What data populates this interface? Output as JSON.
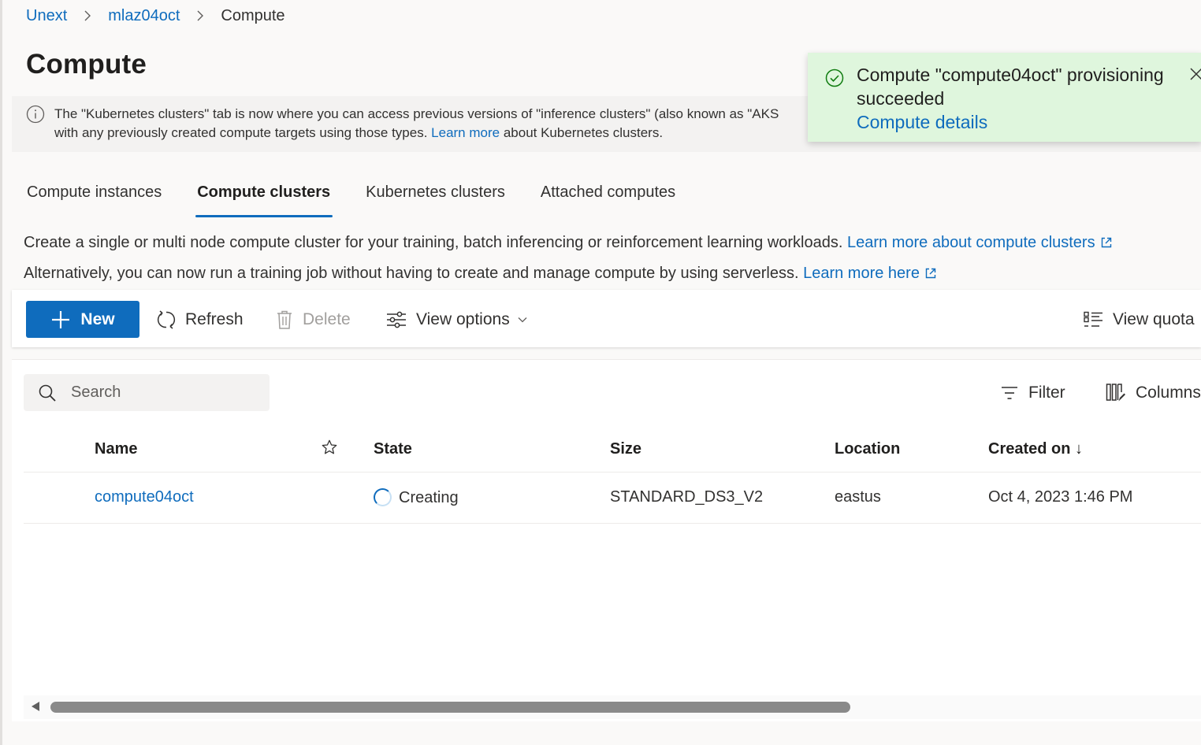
{
  "breadcrumb": [
    "Unext",
    "mlaz04oct",
    "Compute"
  ],
  "page_title": "Compute",
  "banner": {
    "line1": "The \"Kubernetes clusters\" tab is now where you can access previous versions of \"inference clusters\" (also known as \"AKS",
    "line2_pre": "with any previously created compute targets using those types.",
    "line2_link": "Learn more",
    "line2_post": "about Kubernetes clusters."
  },
  "toast": {
    "message": "Compute \"compute04oct\" provisioning succeeded",
    "link": "Compute details"
  },
  "tabs": [
    {
      "label": "Compute instances",
      "active": false
    },
    {
      "label": "Compute clusters",
      "active": true
    },
    {
      "label": "Kubernetes clusters",
      "active": false
    },
    {
      "label": "Attached computes",
      "active": false
    }
  ],
  "description": {
    "line1": "Create a single or multi node compute cluster for your training, batch inferencing or reinforcement learning workloads.",
    "line1_link": "Learn more about compute clusters",
    "line2": "Alternatively, you can now run a training job without having to create and manage compute by using serverless.",
    "line2_link": "Learn more here"
  },
  "toolbar": {
    "new_label": "New",
    "refresh_label": "Refresh",
    "delete_label": "Delete",
    "view_options_label": "View options",
    "view_quota_label": "View quota"
  },
  "grid": {
    "search_placeholder": "Search",
    "filter_label": "Filter",
    "columns_label": "Columns",
    "headers": {
      "name": "Name",
      "state": "State",
      "size": "Size",
      "location": "Location",
      "created_on": "Created on ↓"
    },
    "rows": [
      {
        "name": "compute04oct",
        "state": "Creating",
        "size": "STANDARD_DS3_V2",
        "location": "eastus",
        "created_on": "Oct 4, 2023 1:46 PM"
      }
    ]
  },
  "colors": {
    "accent": "#0f6cbd",
    "toast_bg": "#dff6dd",
    "success": "#107c10"
  }
}
